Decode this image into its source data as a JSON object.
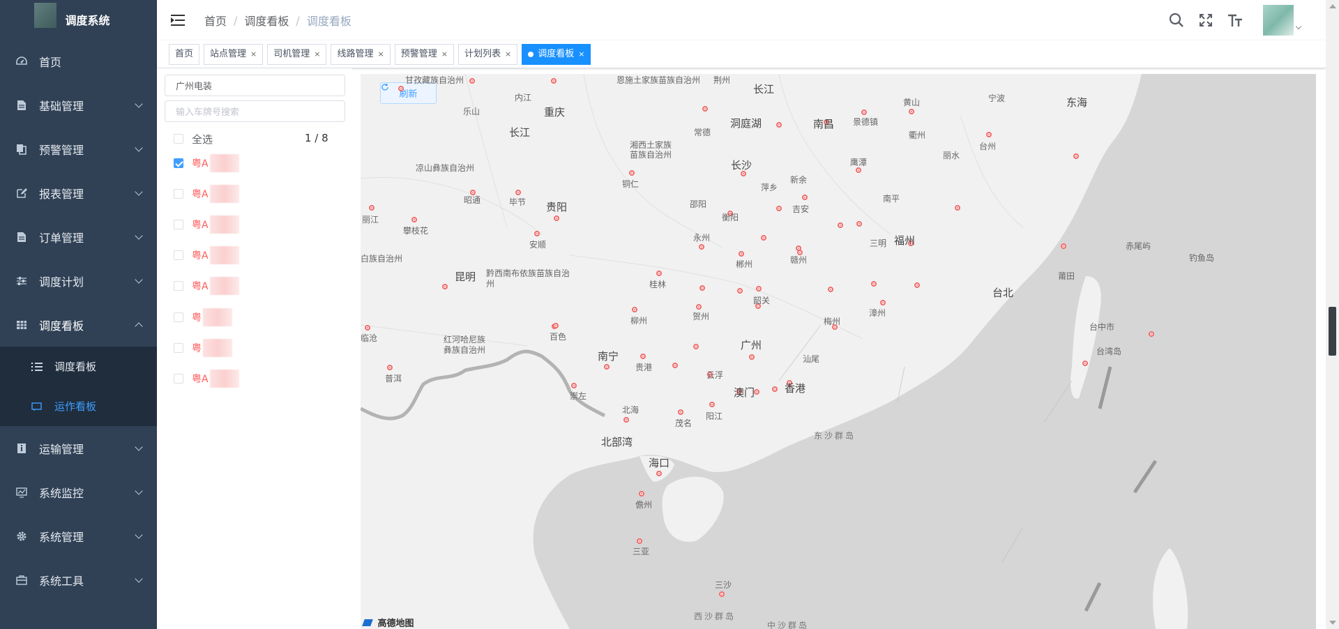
{
  "app": {
    "title": "调度系统"
  },
  "sidebar": {
    "items": [
      {
        "label": "首页",
        "icon": "dashboard-icon"
      },
      {
        "label": "基础管理",
        "icon": "document-icon"
      },
      {
        "label": "预警管理",
        "icon": "copy-icon"
      },
      {
        "label": "报表管理",
        "icon": "edit-icon"
      },
      {
        "label": "订单管理",
        "icon": "document-icon"
      },
      {
        "label": "调度计划",
        "icon": "sliders-icon"
      },
      {
        "label": "调度看板",
        "icon": "table-icon"
      },
      {
        "label": "运输管理",
        "icon": "info-icon"
      },
      {
        "label": "系统监控",
        "icon": "monitor-icon"
      },
      {
        "label": "系统管理",
        "icon": "gear-icon"
      },
      {
        "label": "系统工具",
        "icon": "toolbox-icon"
      }
    ],
    "sub_items": [
      {
        "label": "调度看板",
        "icon": "list-icon"
      },
      {
        "label": "运作看板",
        "icon": "board-icon"
      }
    ]
  },
  "header": {
    "breadcrumb": [
      "首页",
      "调度看板",
      "调度看板"
    ]
  },
  "tags": [
    "首页",
    "站点管理",
    "司机管理",
    "线路管理",
    "预警管理",
    "计划列表",
    "调度看板"
  ],
  "panel": {
    "company_value": "广州电装",
    "search_placeholder": "输入车牌号搜索",
    "select_all": "全选",
    "page_indicator": "1 / 8",
    "vehicles": [
      "粤A",
      "粤A",
      "粤A",
      "粤A",
      "粤A",
      "粤",
      "粤",
      "粤A"
    ]
  },
  "map": {
    "refresh_label": "刷新",
    "provider": "高德地图",
    "labels": {
      "c01": "甘孜藏族自治州",
      "c02": "恩施土家族苗族自治州",
      "c03": "荆州",
      "c04": "长江",
      "c05": "黄山",
      "c06": "宁波",
      "c07": "东海",
      "c08": "乐山",
      "c09": "内江",
      "c10": "重庆",
      "c11": "长江",
      "c12": "常德",
      "c13": "洞庭湖",
      "c14": "南昌",
      "c15": "景德镇",
      "c16": "衢州",
      "c17": "台州",
      "c18": "湘西土家族苗族自治州",
      "c19": "长沙",
      "c20": "丽水",
      "c21": "凉山彝族自治州",
      "c22": "铜仁",
      "c23": "萍乡",
      "c24": "新余",
      "c25": "鹰潭",
      "c26": "昭通",
      "c27": "毕节",
      "c28": "贵阳",
      "c29": "邵阳",
      "c30": "衡阳",
      "c31": "吉安",
      "c32": "南平",
      "c33": "丽江",
      "c34": "攀枝花",
      "c35": "安顺",
      "c36": "永州",
      "c37": "三明",
      "c38": "福州",
      "c39": "赤尾屿",
      "c40": "白族自治州",
      "c41": "钓鱼岛",
      "c42": "郴州",
      "c43": "赣州",
      "c44": "莆田",
      "c45": "昆明",
      "c46": "黔西南布依族苗族自治州",
      "c47": "桂林",
      "c48": "台北",
      "c49": "韶关",
      "c50": "贺州",
      "c51": "漳州",
      "c52": "梅州",
      "c53": "柳州",
      "c54": "台中市",
      "c55": "临沧",
      "c56": "百色",
      "c57": "红河哈尼族彝族自治州",
      "c58": "台湾岛",
      "c59": "广州",
      "c60": "南宁",
      "c61": "汕尾",
      "c62": "贵港",
      "c63": "云浮",
      "c64": "普洱",
      "c65": "澳门",
      "c66": "香港",
      "c67": "崇左",
      "c68": "北海",
      "c69": "阳江",
      "c70": "茂名",
      "c71": "东沙群岛",
      "c72": "北部湾",
      "c73": "海口",
      "c74": "儋州",
      "c75": "三亚",
      "c76": "三沙",
      "c77": "西沙群岛",
      "c78": "中沙群岛"
    }
  },
  "colors": {
    "sidebar_bg": "#304156",
    "accent": "#1890ff",
    "plate_red": "#ff5a5a"
  }
}
